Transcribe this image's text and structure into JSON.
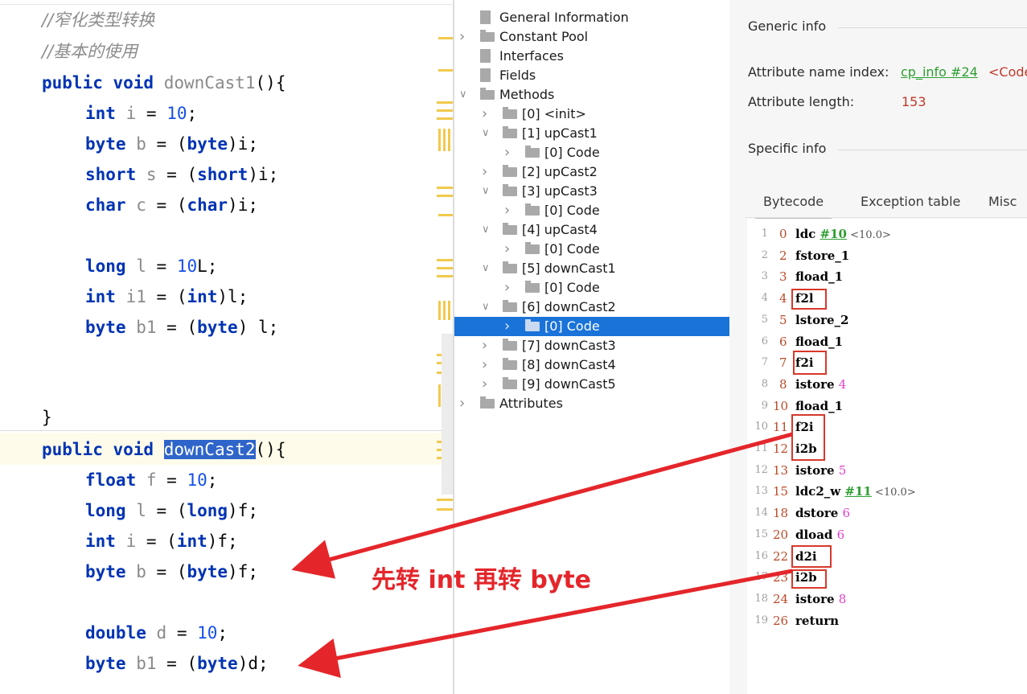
{
  "editor": {
    "lines": [
      {
        "kind": "comment",
        "text": "//窄化类型转换"
      },
      {
        "kind": "comment",
        "text": "//基本的使用"
      },
      {
        "kind": "code",
        "kw1": "public void",
        "name": "downCast1",
        "rest": "(){"
      },
      {
        "kind": "code",
        "kw1": "int",
        "var": "i",
        "mid": " = ",
        "num": "10",
        "rest": ";"
      },
      {
        "kind": "code",
        "kw1": "byte",
        "var": "b",
        "mid": " = (",
        "kw2": "byte",
        "rest": ")i;"
      },
      {
        "kind": "code",
        "kw1": "short",
        "var": "s",
        "mid": " = (",
        "kw2": "short",
        "rest": ")i;"
      },
      {
        "kind": "code",
        "kw1": "char",
        "var": "c",
        "mid": " = (",
        "kw2": "char",
        "rest": ")i;"
      },
      {
        "kind": "code",
        "kw1": "long",
        "var": "l",
        "mid": " = ",
        "num": "10",
        "rest": "L;"
      },
      {
        "kind": "code",
        "kw1": "int",
        "var": "i1",
        "mid": " = (",
        "kw2": "int",
        "rest": ")l;"
      },
      {
        "kind": "code",
        "kw1": "byte",
        "var": "b1",
        "mid": " = (",
        "kw2": "byte",
        "rest": ") l;"
      },
      {
        "kind": "code",
        "text": "}"
      },
      {
        "kind": "code",
        "kw1": "public void",
        "name": "downCast2",
        "rest": "(){"
      },
      {
        "kind": "code",
        "kw1": "float",
        "var": "f",
        "mid": " = ",
        "num": "10",
        "rest": ";"
      },
      {
        "kind": "code",
        "kw1": "long",
        "var": "l",
        "mid": " = (",
        "kw2": "long",
        "rest": ")f;"
      },
      {
        "kind": "code",
        "kw1": "int",
        "var": "i",
        "mid": " = (",
        "kw2": "int",
        "rest": ")f;"
      },
      {
        "kind": "code",
        "kw1": "byte",
        "var": "b",
        "mid": " = (",
        "kw2": "byte",
        "rest": ")f;"
      },
      {
        "kind": "code",
        "kw1": "double",
        "var": "d",
        "mid": " = ",
        "num": "10",
        "rest": ";"
      },
      {
        "kind": "code",
        "kw1": "byte",
        "var": "b1",
        "mid": " = (",
        "kw2": "byte",
        "rest": ")d;"
      }
    ]
  },
  "tree": {
    "items": [
      {
        "label": "General Information",
        "chevron": ""
      },
      {
        "label": "Constant Pool",
        "chevron": ">"
      },
      {
        "label": "Interfaces",
        "chevron": ""
      },
      {
        "label": "Fields",
        "chevron": ""
      },
      {
        "label": "Methods",
        "chevron": "v"
      },
      {
        "label": "[0] <init>",
        "chevron": ">"
      },
      {
        "label": "[1] upCast1",
        "chevron": "v"
      },
      {
        "label": "[0] Code",
        "chevron": ">"
      },
      {
        "label": "[2] upCast2",
        "chevron": ">"
      },
      {
        "label": "[3] upCast3",
        "chevron": "v"
      },
      {
        "label": "[0] Code",
        "chevron": ">"
      },
      {
        "label": "[4] upCast4",
        "chevron": "v"
      },
      {
        "label": "[0] Code",
        "chevron": ">"
      },
      {
        "label": "[5] downCast1",
        "chevron": "v"
      },
      {
        "label": "[0] Code",
        "chevron": ">"
      },
      {
        "label": "[6] downCast2",
        "chevron": "v"
      },
      {
        "label": "[0] Code",
        "chevron": ">"
      },
      {
        "label": "[7] downCast3",
        "chevron": ">"
      },
      {
        "label": "[8] downCast4",
        "chevron": ">"
      },
      {
        "label": "[9] downCast5",
        "chevron": ">"
      },
      {
        "label": "Attributes",
        "chevron": ">"
      }
    ]
  },
  "details": {
    "generic_title": "Generic info",
    "attr_name_label": "Attribute name index:",
    "attr_name_link": "cp_info #24",
    "attr_name_value": "<Code>",
    "attr_len_label": "Attribute length:",
    "attr_len_value": "153",
    "specific_title": "Specific info",
    "tabs": [
      "Bytecode",
      "Exception table",
      "Misc"
    ],
    "active_tab": "Bytecode"
  },
  "bytecode": [
    {
      "ln": "1",
      "off": "0",
      "op": "ldc ",
      "cp": "#10",
      "comment": " <10.0>"
    },
    {
      "ln": "2",
      "off": "2",
      "op": "fstore_1"
    },
    {
      "ln": "3",
      "off": "3",
      "op": "fload_1"
    },
    {
      "ln": "4",
      "off": "4",
      "op": "f2l"
    },
    {
      "ln": "5",
      "off": "5",
      "op": "lstore_2"
    },
    {
      "ln": "6",
      "off": "6",
      "op": "fload_1"
    },
    {
      "ln": "7",
      "off": "7",
      "op": "f2i"
    },
    {
      "ln": "8",
      "off": "8",
      "op": "istore ",
      "arg": "4"
    },
    {
      "ln": "9",
      "off": "10",
      "op": "fload_1"
    },
    {
      "ln": "10",
      "off": "11",
      "op": "f2i"
    },
    {
      "ln": "11",
      "off": "12",
      "op": "i2b"
    },
    {
      "ln": "12",
      "off": "13",
      "op": "istore ",
      "arg": "5"
    },
    {
      "ln": "13",
      "off": "15",
      "op": "ldc2_w ",
      "cp": "#11",
      "comment": " <10.0>"
    },
    {
      "ln": "14",
      "off": "18",
      "op": "dstore ",
      "arg": "6"
    },
    {
      "ln": "15",
      "off": "20",
      "op": "dload ",
      "arg": "6"
    },
    {
      "ln": "16",
      "off": "22",
      "op": "d2i"
    },
    {
      "ln": "17",
      "off": "23",
      "op": "i2b"
    },
    {
      "ln": "18",
      "off": "24",
      "op": "istore ",
      "arg": "8"
    },
    {
      "ln": "19",
      "off": "26",
      "op": "return"
    }
  ],
  "annotation": {
    "text": "先转 int 再转 byte",
    "color": "#e4262b"
  },
  "colors": {
    "keyword": "#0033b3",
    "number": "#1750eb",
    "selection": "#2f65ca",
    "tree_selection": "#1a73d9",
    "link": "#2e9e31"
  }
}
